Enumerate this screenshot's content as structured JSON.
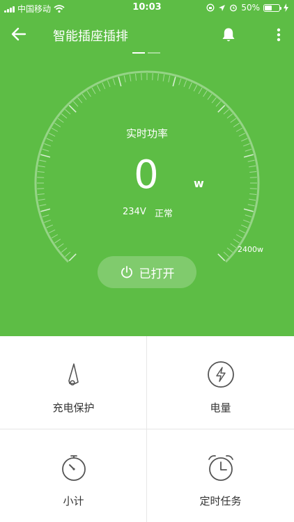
{
  "status_bar": {
    "carrier": "中国移动",
    "time": "10:03",
    "battery": "50%"
  },
  "nav": {
    "title": "智能插座插排"
  },
  "gauge": {
    "label": "实时功率",
    "power_value": "0",
    "power_unit": "w",
    "voltage": "234V",
    "status": "正常",
    "max_label": "2400w",
    "level_fraction": 0
  },
  "switch": {
    "label": "已打开"
  },
  "menu": {
    "items": [
      {
        "label": "充电保护",
        "icon": "charging-protection-icon"
      },
      {
        "label": "电量",
        "icon": "lightning-icon"
      },
      {
        "label": "小计",
        "icon": "stopwatch-icon"
      },
      {
        "label": "定时任务",
        "icon": "alarm-clock-icon"
      }
    ]
  },
  "colors": {
    "primary_green": "#5dbd45",
    "icon_gray": "#555555"
  }
}
